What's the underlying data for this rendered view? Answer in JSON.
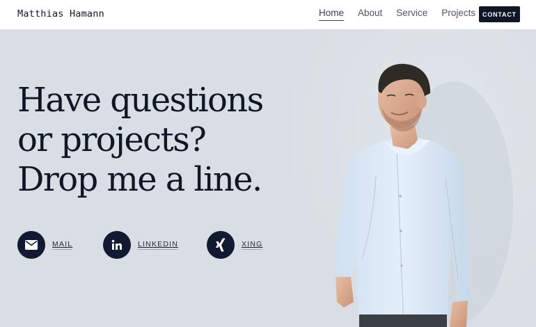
{
  "header": {
    "brand": "Matthias Hamann",
    "nav": [
      "Home",
      "About",
      "Service",
      "Projects"
    ],
    "active_nav": "Home",
    "contact_label": "CONTACT"
  },
  "hero": {
    "headline_lines": [
      "Have questions",
      "or projects?",
      "Drop me a line."
    ]
  },
  "social": [
    {
      "label": "MAIL",
      "icon": "mail-icon"
    },
    {
      "label": "LINKEDIN",
      "icon": "linkedin-icon"
    },
    {
      "label": "XING",
      "icon": "xing-icon"
    }
  ],
  "colors": {
    "background": "#d8dee3",
    "accent_dark": "#0f1626",
    "header_bg": "#ffffff"
  }
}
